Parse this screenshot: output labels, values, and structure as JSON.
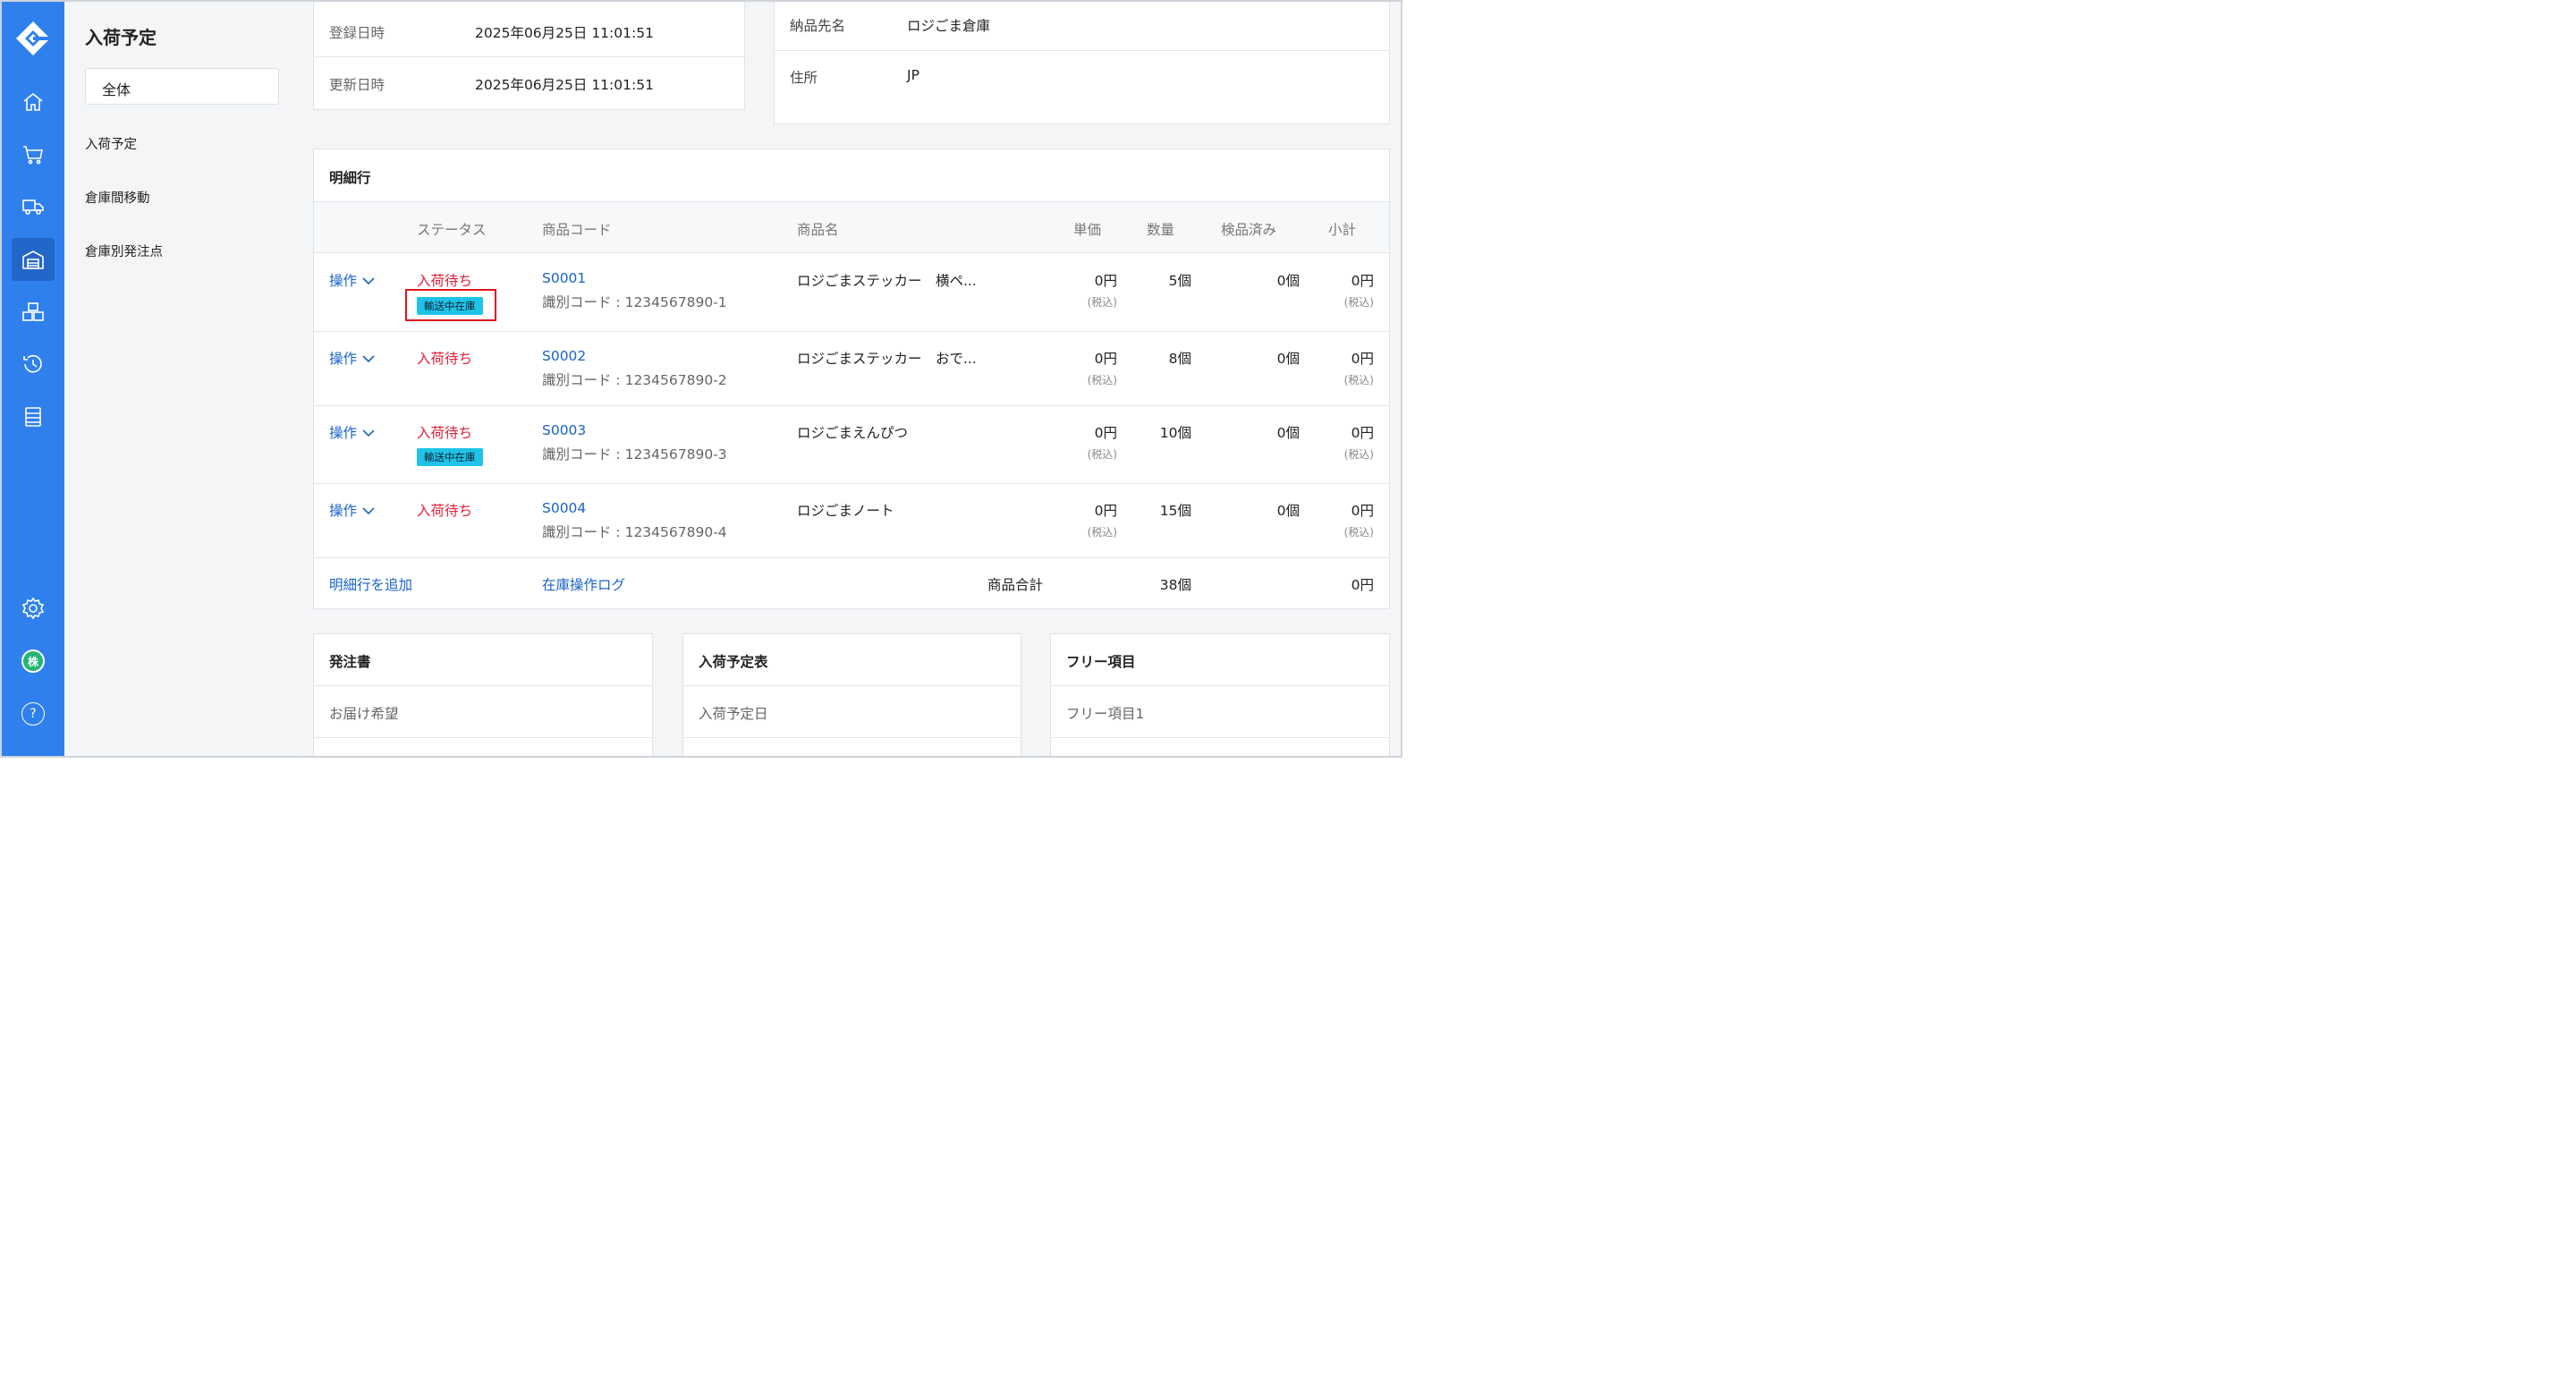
{
  "sidebar": {
    "title": "入荷予定",
    "scope": "全体",
    "nav": [
      "入荷予定",
      "倉庫間移動",
      "倉庫別発注点"
    ]
  },
  "rail": {
    "icons": [
      "logo-icon",
      "home-icon",
      "cart-icon",
      "truck-icon",
      "warehouse-icon",
      "boxes-icon",
      "history-icon",
      "server-icon",
      "settings-icon",
      "company-icon",
      "help-icon"
    ],
    "company_label": "株",
    "help_label": "?"
  },
  "info": {
    "registered_label": "登録日時",
    "registered_value": "2025年06月25日 11:01:51",
    "updated_label": "更新日時",
    "updated_value": "2025年06月25日 11:01:51",
    "dest_label": "納品先名",
    "dest_value": "ロジごま倉庫",
    "address_label": "住所",
    "address_value": "JP"
  },
  "details": {
    "title": "明細行",
    "headers": {
      "status": "ステータス",
      "code": "商品コード",
      "name": "商品名",
      "price": "単価",
      "qty": "数量",
      "inspected": "検品済み",
      "subtotal": "小計"
    },
    "rows": [
      {
        "action": "操作",
        "status": "入荷待ち",
        "badge": "輸送中在庫",
        "code": "S0001",
        "ident": "識別コード : 1234567890-1",
        "name": "ロジごまステッカー　横ペ...",
        "price": "0円",
        "price_tax": "(税込)",
        "qty": "5個",
        "inspected": "0個",
        "subtotal": "0円",
        "subtotal_tax": "(税込)"
      },
      {
        "action": "操作",
        "status": "入荷待ち",
        "badge": "",
        "code": "S0002",
        "ident": "識別コード : 1234567890-2",
        "name": "ロジごまステッカー　おで...",
        "price": "0円",
        "price_tax": "(税込)",
        "qty": "8個",
        "inspected": "0個",
        "subtotal": "0円",
        "subtotal_tax": "(税込)"
      },
      {
        "action": "操作",
        "status": "入荷待ち",
        "badge": "輸送中在庫",
        "code": "S0003",
        "ident": "識別コード : 1234567890-3",
        "name": "ロジごまえんぴつ",
        "price": "0円",
        "price_tax": "(税込)",
        "qty": "10個",
        "inspected": "0個",
        "subtotal": "0円",
        "subtotal_tax": "(税込)"
      },
      {
        "action": "操作",
        "status": "入荷待ち",
        "badge": "",
        "code": "S0004",
        "ident": "識別コード : 1234567890-4",
        "name": "ロジごまノート",
        "price": "0円",
        "price_tax": "(税込)",
        "qty": "15個",
        "inspected": "0個",
        "subtotal": "0円",
        "subtotal_tax": "(税込)"
      }
    ],
    "footer": {
      "add_line": "明細行を追加",
      "stock_log": "在庫操作ログ",
      "total_label": "商品合計",
      "total_qty": "38個",
      "total_amount": "0円"
    }
  },
  "bottom_cards": [
    {
      "title": "発注書",
      "first_label": "お届け希望"
    },
    {
      "title": "入荷予定表",
      "first_label": "入荷予定日"
    },
    {
      "title": "フリー項目",
      "first_label": "フリー項目1"
    }
  ],
  "colors": {
    "rail": "#2f80ed",
    "link": "#1a63c9",
    "status_red": "#e0203b",
    "badge": "#1fc3e8",
    "highlight": "#e0141e",
    "company_badge": "#21b573"
  }
}
